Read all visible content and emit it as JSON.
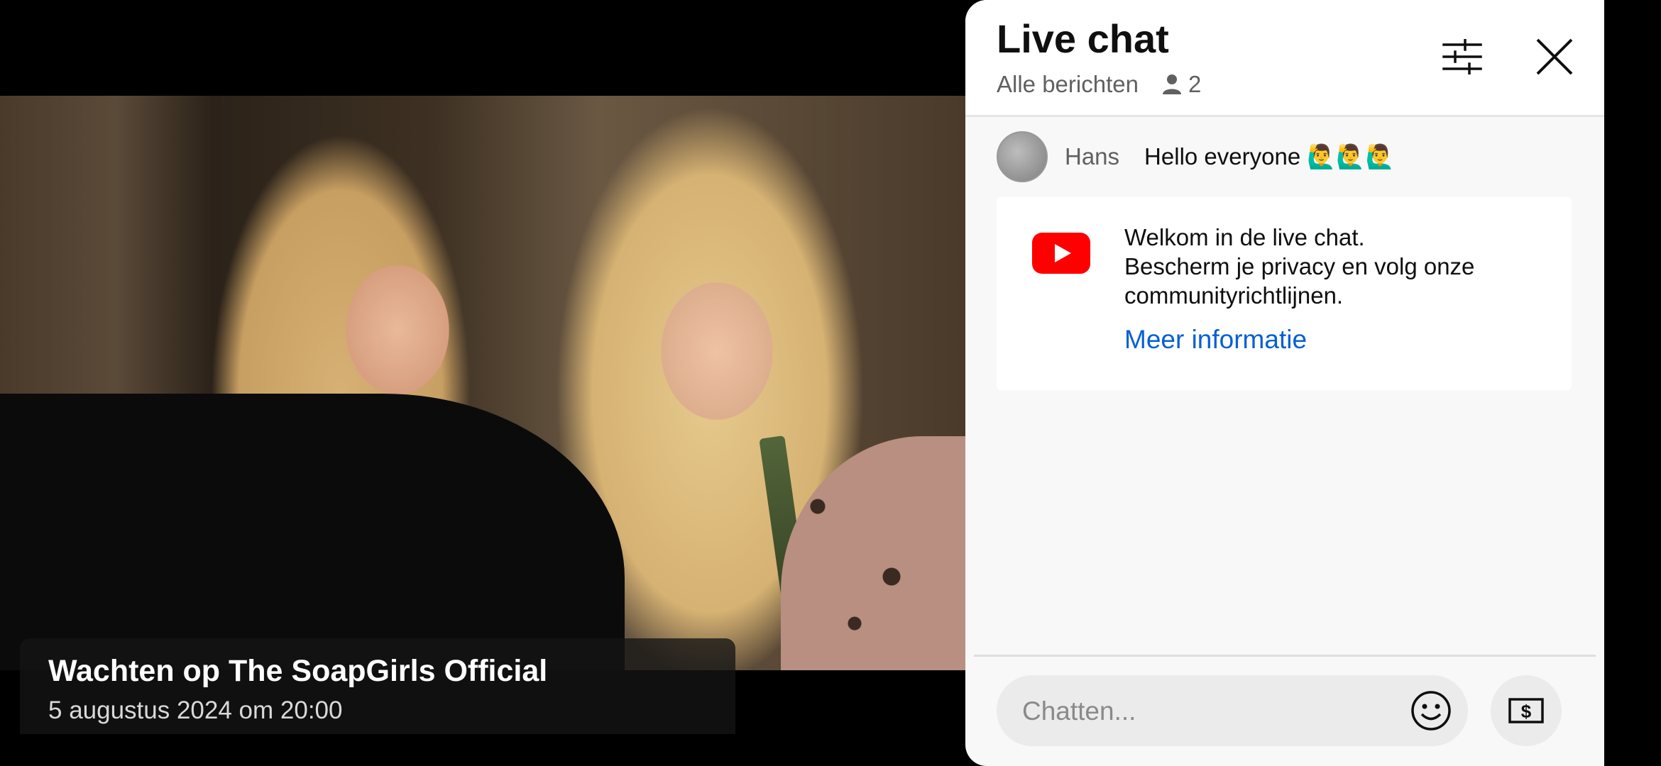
{
  "video": {
    "title": "Wachten op The SoapGirls Official",
    "date": "5 augustus 2024 om 20:00"
  },
  "chat": {
    "title": "Live chat",
    "filter_label": "Alle berichten",
    "viewer_count": "2",
    "messages": [
      {
        "author": "Hans",
        "text": "Hello everyone 🙋‍♂️🙋‍♂️🙋‍♂️"
      }
    ],
    "welcome": {
      "line1": "Welkom in de live chat.",
      "line2": "Bescherm je privacy en volg onze communityrichtlijnen.",
      "link": "Meer informatie"
    },
    "input_placeholder": "Chatten...",
    "icons": {
      "filter": "sliders-icon",
      "close": "close-icon",
      "viewer": "person-icon",
      "emoji": "smiley-icon",
      "money": "super-chat-money-icon",
      "logo": "youtube-logo-icon"
    }
  },
  "colors": {
    "link": "#065fd4",
    "youtube_red": "#ff0000",
    "panel_bg": "#f8f8f8"
  }
}
